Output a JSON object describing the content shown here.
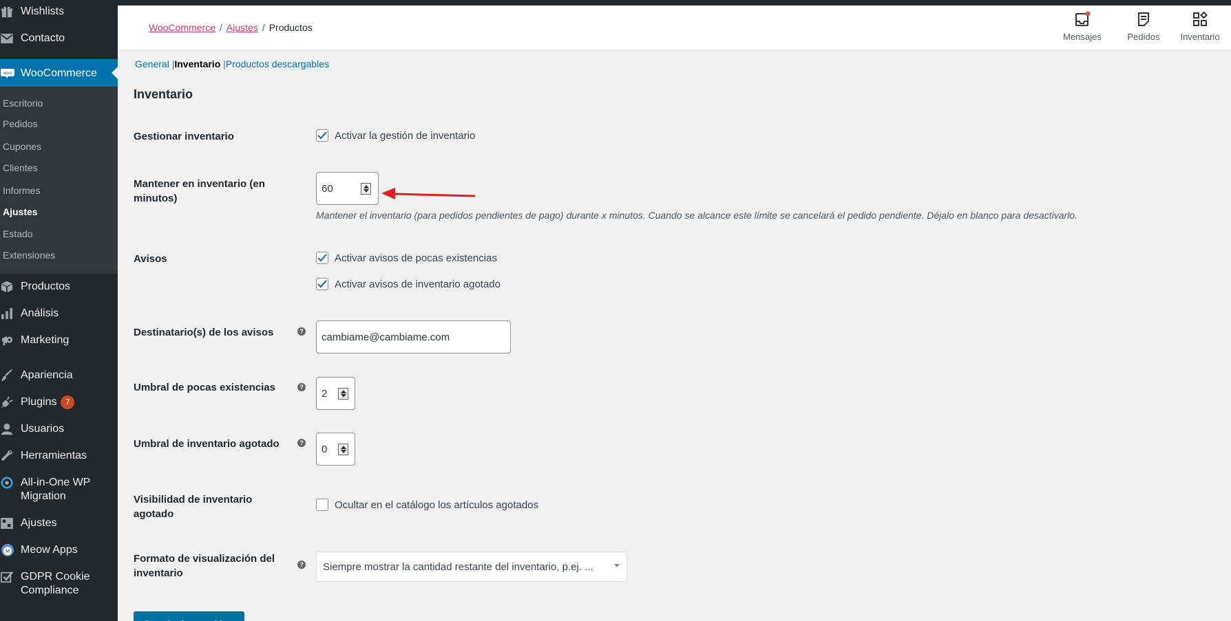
{
  "sidebar": {
    "items_top": [
      {
        "label": "Wishlists",
        "icon": "gift-icon"
      },
      {
        "label": "Contacto",
        "icon": "mail-icon"
      }
    ],
    "woocommerce": {
      "label": "WooCommerce",
      "icon": "woo-icon"
    },
    "submenu": [
      {
        "label": "Escritorio"
      },
      {
        "label": "Pedidos"
      },
      {
        "label": "Cupones"
      },
      {
        "label": "Clientes"
      },
      {
        "label": "Informes"
      },
      {
        "label": "Ajustes",
        "current": true
      },
      {
        "label": "Estado"
      },
      {
        "label": "Extensiones"
      }
    ],
    "items_bottom": [
      {
        "label": "Productos",
        "icon": "box-icon"
      },
      {
        "label": "Análisis",
        "icon": "bar-chart-icon"
      },
      {
        "label": "Marketing",
        "icon": "megaphone-icon"
      },
      {
        "label": "Apariencia",
        "icon": "brush-icon"
      },
      {
        "label": "Plugins",
        "icon": "plug-icon",
        "badge": "7"
      },
      {
        "label": "Usuarios",
        "icon": "user-icon"
      },
      {
        "label": "Herramientas",
        "icon": "wrench-icon"
      },
      {
        "label": "All-in-One WP Migration",
        "icon": "migration-icon"
      },
      {
        "label": "Ajustes",
        "icon": "settings-icon"
      },
      {
        "label": "Meow Apps",
        "icon": "meow-icon"
      },
      {
        "label": "GDPR Cookie Compliance",
        "icon": "checkbox-icon"
      }
    ]
  },
  "header": {
    "breadcrumb": {
      "root": "WooCommerce",
      "sep": "/",
      "parent": "Ajustes",
      "current": "Productos"
    },
    "actions": [
      {
        "label": "Mensajes",
        "icon": "inbox-icon",
        "notification_color": "#d94f4f"
      },
      {
        "label": "Pedidos",
        "icon": "document-icon"
      },
      {
        "label": "Inventario",
        "icon": "inventory-icon"
      }
    ]
  },
  "subtabs": {
    "general": "General",
    "inventario": "Inventario",
    "descargables": "Productos descargables",
    "sep": "|"
  },
  "section_title": "Inventario",
  "fields": {
    "manage_stock": {
      "label": "Gestionar inventario",
      "checkbox_label": "Activar la gestión de inventario",
      "checked": true
    },
    "hold_stock": {
      "label": "Mantener en inventario (en minutos)",
      "value": "60",
      "description": "Mantener el inventario (para pedidos pendientes de pago) durante x minutos. Cuando se alcance este límite se cancelará el pedido pendiente. Déjalo en blanco para desactivarlo."
    },
    "notifications": {
      "label": "Avisos",
      "low_stock_label": "Activar avisos de pocas existencias",
      "out_of_stock_label": "Activar avisos de inventario agotado",
      "low_checked": true,
      "out_checked": true
    },
    "recipient": {
      "label": "Destinatario(s) de los avisos",
      "value": "cambiame@cambiame.com"
    },
    "low_threshold": {
      "label": "Umbral de pocas existencias",
      "value": "2"
    },
    "out_threshold": {
      "label": "Umbral de inventario agotado",
      "value": "0"
    },
    "visibility": {
      "label": "Visibilidad de inventario agotado",
      "checkbox_label": "Ocultar en el catálogo los artículos agotados",
      "checked": false
    },
    "format": {
      "label": "Formato de visualización del inventario",
      "selected": "Siempre mostrar la cantidad restante del inventario, p.ej. ..."
    }
  },
  "help_tip_glyph": "?",
  "save_button": "Guardar los cambios",
  "colors": {
    "sidebar_bg": "#23282d",
    "accent": "#0073aa",
    "breadcrumb_link": "#c9386b",
    "annotation_arrow": "#e02020"
  }
}
